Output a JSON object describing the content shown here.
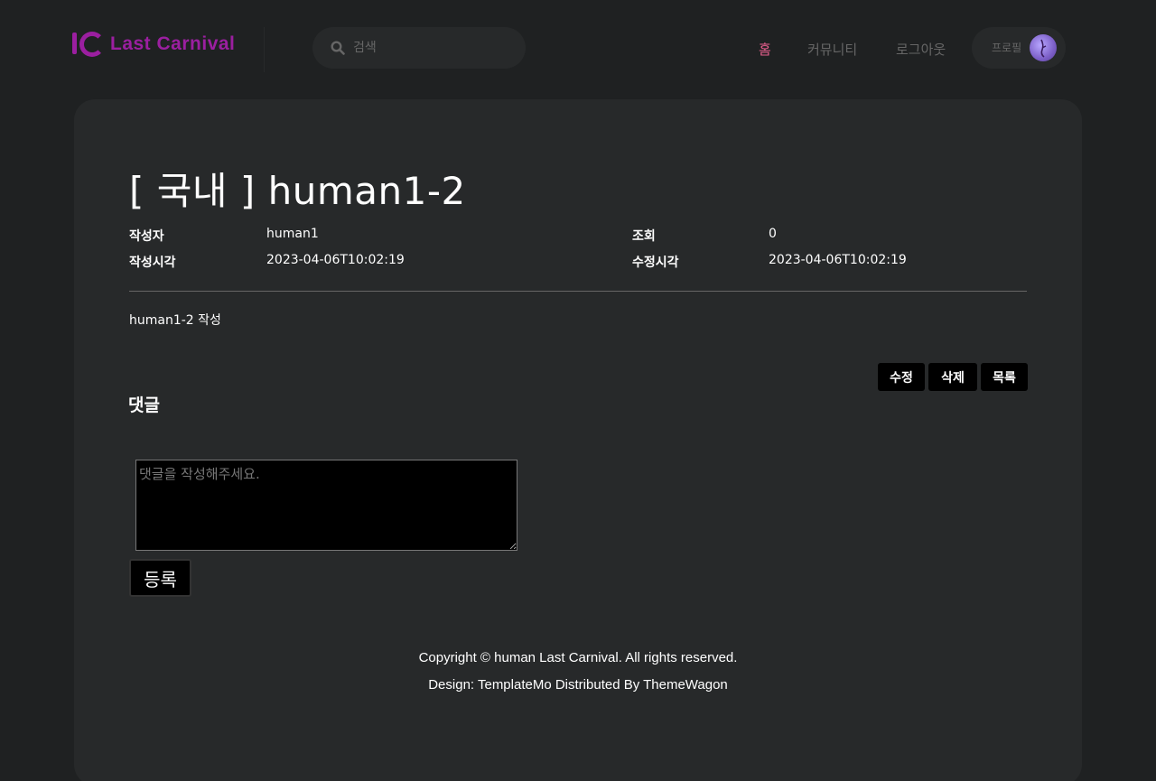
{
  "brand": {
    "name": "Last Carnival",
    "color": "#9b1fa0"
  },
  "search": {
    "placeholder": "검색",
    "icon": "search-icon"
  },
  "nav": {
    "items": [
      {
        "label": "홈",
        "active": true
      },
      {
        "label": "커뮤니티",
        "active": false
      },
      {
        "label": "로그아웃",
        "active": false
      }
    ],
    "active_color": "#e75e8d"
  },
  "profile": {
    "label": "프로필",
    "icon": "avatar-icon"
  },
  "post": {
    "title": "[ 국내 ] human1-2",
    "author_label": "작성자",
    "author": "human1",
    "views_label": "조회",
    "views": "0",
    "created_label": "작성시각",
    "created": "2023-04-06T10:02:19",
    "modified_label": "수정시각",
    "modified": "2023-04-06T10:02:19",
    "body": "human1-2 작성"
  },
  "actions": {
    "edit": "수정",
    "delete": "삭제",
    "list": "목록"
  },
  "comments": {
    "heading": "댓글",
    "placeholder": "댓글을 작성해주세요.",
    "submit": "등록"
  },
  "footer": {
    "copyright": "Copyright © human Last Carnival. All rights reserved.",
    "design": "Design: TemplateMo Distributed By ThemeWagon"
  }
}
